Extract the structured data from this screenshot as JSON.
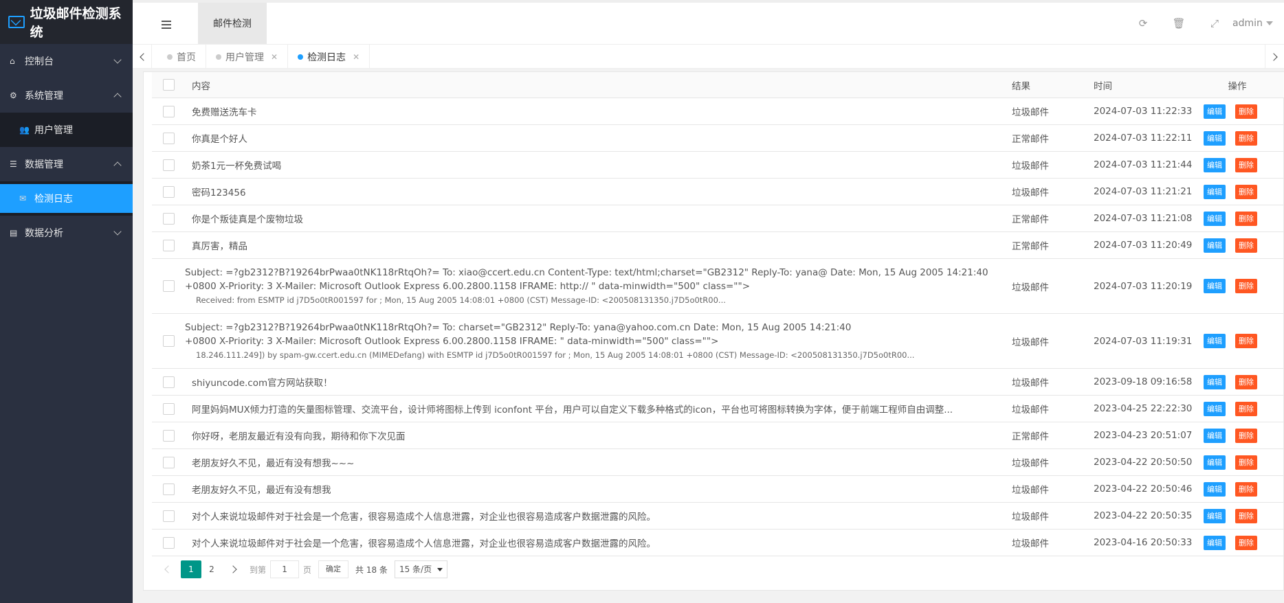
{
  "app": {
    "title": "垃圾邮件检测系统"
  },
  "sidebar": {
    "items": [
      {
        "label": "控制台",
        "icon": "home-icon"
      },
      {
        "label": "系统管理",
        "icon": "gears-icon"
      },
      {
        "label": "用户管理",
        "icon": "users-icon"
      },
      {
        "label": "数据管理",
        "icon": "database-icon"
      },
      {
        "label": "检测日志",
        "icon": "mail-icon"
      },
      {
        "label": "数据分析",
        "icon": "book-icon"
      }
    ]
  },
  "header": {
    "tab_label": "邮件检测",
    "user": "admin",
    "icons": [
      "refresh-icon",
      "trash-icon",
      "fullscreen-icon"
    ]
  },
  "tabs": [
    {
      "label": "首页"
    },
    {
      "label": "用户管理"
    },
    {
      "label": "检测日志"
    }
  ],
  "table": {
    "headers": {
      "content": "内容",
      "result": "结果",
      "time": "时间",
      "ops": "操作"
    },
    "edit_label": "编辑",
    "delete_label": "删除",
    "rows": [
      {
        "content": "免费赠送洗车卡",
        "result": "垃圾邮件",
        "time": "2024-07-03 11:22:33"
      },
      {
        "content": "你真是个好人",
        "result": "正常邮件",
        "time": "2024-07-03 11:22:11"
      },
      {
        "content": "奶茶1元一杯免费试喝",
        "result": "垃圾邮件",
        "time": "2024-07-03 11:21:44"
      },
      {
        "content": "密码123456",
        "result": "垃圾邮件",
        "time": "2024-07-03 11:21:21"
      },
      {
        "content": "你是个叛徒真是个废物垃圾",
        "result": "正常邮件",
        "time": "2024-07-03 11:21:08"
      },
      {
        "content": "真厉害，精品",
        "result": "正常邮件",
        "time": "2024-07-03 11:20:49"
      },
      {
        "content_l1": "Subject: =?gb2312?B?19264brPwaa0tNK118rRtqOh?= To: xiao@ccert.edu.cn Content-Type: text/html;charset=\"GB2312\" Reply-To: yana@ Date: Mon, 15 Aug 2005 14:21:40",
        "content_l2": "+0800 X-Priority: 3 X-Mailer: Microsoft Outlook Express 6.00.2800.1158 IFRAME: http:// \" data-minwidth=\"500\" class=\"\">",
        "content_l3": "Received: from ESMTP id j7D5o0tR001597 for ; Mon, 15 Aug 2005 14:08:01 +0800 (CST) Message-ID: <200508131350.j7D5o0tR00...",
        "result": "垃圾邮件",
        "time": "2024-07-03 11:20:19"
      },
      {
        "content_l1": "Subject: =?gb2312?B?19264brPwaa0tNK118rRtqOh?= To: charset=\"GB2312\" Reply-To: yana@yahoo.com.cn Date: Mon, 15 Aug 2005 14:21:40",
        "content_l2": "+0800 X-Priority: 3 X-Mailer: Microsoft Outlook Express 6.00.2800.1158 IFRAME: \" data-minwidth=\"500\" class=\"\">",
        "content_l3": "18.246.111.249]) by spam-gw.ccert.edu.cn (MIMEDefang) with ESMTP id j7D5o0tR001597 for ; Mon, 15 Aug 2005 14:08:01 +0800 (CST) Message-ID: <200508131350.j7D5o0tR00...",
        "result": "垃圾邮件",
        "time": "2024-07-03 11:19:31"
      },
      {
        "content": "shiyuncode.com官方网站获取！",
        "result": "垃圾邮件",
        "time": "2023-09-18 09:16:58"
      },
      {
        "content": "阿里妈妈MUX倾力打造的矢量图标管理、交流平台，设计师将图标上传到 iconfont 平台，用户可以自定义下载多种格式的icon，平台也可将图标转换为字体，便于前端工程师自由调整...",
        "result": "垃圾邮件",
        "time": "2023-04-25 22:22:30"
      },
      {
        "content": "你好呀，老朋友最近有没有向我，期待和你下次见面",
        "result": "正常邮件",
        "time": "2023-04-23 20:51:07"
      },
      {
        "content": "老朋友好久不见，最近有没有想我~~~",
        "result": "垃圾邮件",
        "time": "2023-04-22 20:50:50"
      },
      {
        "content": "老朋友好久不见，最近有没有想我",
        "result": "垃圾邮件",
        "time": "2023-04-22 20:50:46"
      },
      {
        "content": "对个人来说垃圾邮件对于社会是一个危害，很容易造成个人信息泄露，对企业也很容易造成客户数据泄露的风险。",
        "result": "垃圾邮件",
        "time": "2023-04-22 20:50:35"
      },
      {
        "content": "对个人来说垃圾邮件对于社会是一个危害，很容易造成个人信息泄露，对企业也很容易造成客户数据泄露的风险。",
        "result": "垃圾邮件",
        "time": "2023-04-16 20:50:33"
      }
    ]
  },
  "pagination": {
    "pages": [
      "1",
      "2"
    ],
    "goto_label": "到第",
    "page_value": "1",
    "page_unit": "页",
    "confirm_label": "确定",
    "total": "共 18 条",
    "page_size": "15 条/页"
  }
}
